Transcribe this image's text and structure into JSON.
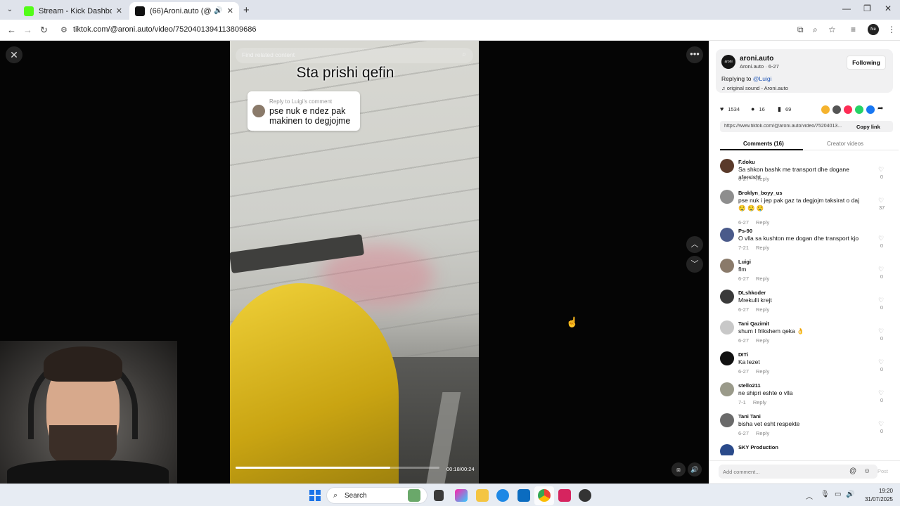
{
  "browser": {
    "tabs": [
      {
        "title": "Stream - Kick Dashboard",
        "active": false,
        "favicon_color": "#53fc18"
      },
      {
        "title": "(66)Aroni.auto (@aroni.auto",
        "active": true,
        "favicon_color": "#111111"
      }
    ],
    "url": "tiktok.com/@aroni.auto/video/7520401394113809686",
    "profile_badge": "Ne"
  },
  "video": {
    "search_placeholder": "Find related content",
    "caption": "Sta prishi qefin",
    "reply_card": {
      "title": "Reply to Luigi's comment",
      "body": "pse nuk e ndez pak makinen to degjojme"
    },
    "progress_fraction": 0.76,
    "time": "00:18/00:24"
  },
  "panel": {
    "creator_name": "aroni.auto",
    "creator_sub": "Aroni.auto · 6-27",
    "follow_label": "Following",
    "replying_prefix": "Replying to ",
    "replying_mention": "@Luigi",
    "sound": "original sound - Aroni.auto",
    "stats": {
      "likes": "1534",
      "comments": "16",
      "saves": "69"
    },
    "share_colors": [
      "#f5b32e",
      "#555555",
      "#fe2c55",
      "#25d366",
      "#1877f2"
    ],
    "link": "https://www.tiktok.com/@aroni.auto/video/75204013...",
    "copy_label": "Copy link",
    "tab_comments": "Comments (16)",
    "tab_creator": "Creator videos",
    "add_comment_placeholder": "Add comment...",
    "post_label": "Post"
  },
  "comments": [
    {
      "user": "F.doku",
      "text": "Sa shkon bashk me transport dhe dogane afersisht",
      "date": "6-27",
      "reply": "Reply",
      "likes": "0",
      "avatar_color": "#5a3a2a"
    },
    {
      "user": "Broklyn_boyy_us",
      "text": "pse nuk i jep pak gaz ta degjojm taksirat o daj 🤤 🤤 🤤",
      "date": "6-27",
      "reply": "Reply",
      "likes": "37",
      "avatar_color": "#8e8e8e"
    },
    {
      "user": "Ps-90",
      "text": "O vlla sa kushton me dogan dhe transport kjo",
      "date": "7-21",
      "reply": "Reply",
      "likes": "0",
      "avatar_color": "#4a5a8a"
    },
    {
      "user": "Luigi",
      "text": "flm",
      "date": "6-27",
      "reply": "Reply",
      "likes": "0",
      "avatar_color": "#8a7a6a"
    },
    {
      "user": "DLshkoder",
      "text": "Mrekulli krejt",
      "date": "6-27",
      "reply": "Reply",
      "likes": "0",
      "avatar_color": "#3a3a3a"
    },
    {
      "user": "Tani Qazimit",
      "text": "shum I frikshem qeka 👌",
      "date": "6-27",
      "reply": "Reply",
      "likes": "0",
      "avatar_color": "#c8c8c8"
    },
    {
      "user": "DITi",
      "text": "Ka lezet",
      "date": "6-27",
      "reply": "Reply",
      "likes": "0",
      "avatar_color": "#111111"
    },
    {
      "user": "stello211",
      "text": "ne shipri eshte o vlla",
      "date": "7-1",
      "reply": "Reply",
      "likes": "0",
      "avatar_color": "#9a9a8a"
    },
    {
      "user": "Tani Tani",
      "text": "bisha vet esht respekte",
      "date": "6-27",
      "reply": "Reply",
      "likes": "0",
      "avatar_color": "#6a6a6a"
    },
    {
      "user": "SKY Production",
      "text": "",
      "date": "",
      "reply": "",
      "likes": "",
      "avatar_color": "#2a4a8a"
    }
  ],
  "taskbar": {
    "search_label": "Search",
    "time": "19:20",
    "date": "31/07/2025"
  }
}
